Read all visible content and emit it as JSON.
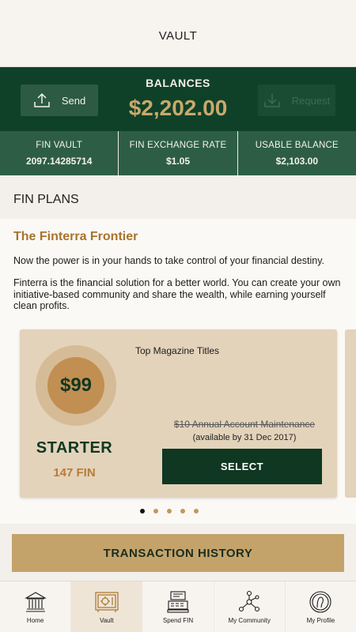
{
  "header": {
    "title": "VAULT"
  },
  "balance": {
    "title": "BALANCES",
    "amount": "$2,202.00",
    "send_label": "Send",
    "request_label": "Request"
  },
  "stats": [
    {
      "label": "FIN VAULT",
      "value": "2097.14285714"
    },
    {
      "label": "FIN EXCHANGE RATE",
      "value": "$1.05"
    },
    {
      "label": "USABLE BALANCE",
      "value": "$2,103.00"
    }
  ],
  "plans": {
    "section_title": "FIN PLANS",
    "title": "The Finterra Frontier",
    "intro": "Now the power is in your hands to take control of your financial destiny.",
    "description": "Finterra is the financial solution for a better world. You can create your own initiative-based community and share the wealth, while earning yourself clean profits."
  },
  "plan_card": {
    "price": "$99",
    "tier": "STARTER",
    "fin": "147 FIN",
    "perk": "Top Magazine Titles",
    "maintenance": "$10 Annual Account Maintenance",
    "availability": "(available by 31 Dec 2017)",
    "select_label": "SELECT"
  },
  "carousel": {
    "count": 5,
    "active_index": 0
  },
  "transaction_history_label": "TRANSACTION HISTORY",
  "nav": {
    "items": [
      {
        "label": "Home",
        "icon": "bank-icon"
      },
      {
        "label": "Vault",
        "icon": "safe-icon"
      },
      {
        "label": "Spend FIN",
        "icon": "register-icon"
      },
      {
        "label": "My Community",
        "icon": "network-icon"
      },
      {
        "label": "My Profile",
        "icon": "coin-profile-icon"
      }
    ],
    "active_index": 1
  },
  "colors": {
    "dark_green": "#0f4129",
    "mid_green": "#2d5e45",
    "gold": "#c9a96b",
    "bronze": "#a8732c",
    "card_bg": "#e3d3bb"
  }
}
